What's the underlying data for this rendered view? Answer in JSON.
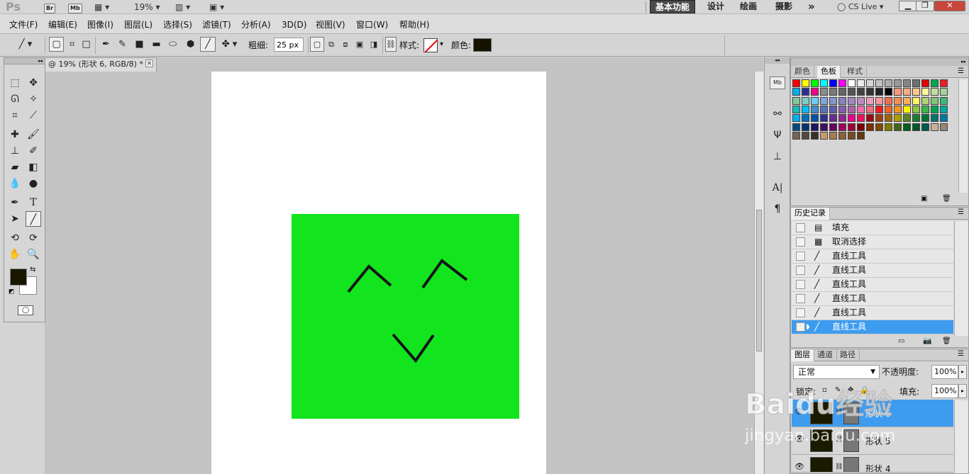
{
  "app_bar": {
    "logo": "Ps",
    "br": "Br",
    "mb": "Mb",
    "zoom": "19%",
    "workspaces": [
      "基本功能",
      "设计",
      "绘画",
      "摄影"
    ],
    "more": "»",
    "cslive": "CS Live"
  },
  "menus": [
    "文件(F)",
    "编辑(E)",
    "图像(I)",
    "图层(L)",
    "选择(S)",
    "滤镜(T)",
    "分析(A)",
    "3D(D)",
    "视图(V)",
    "窗口(W)",
    "帮助(H)"
  ],
  "options": {
    "weight_label": "粗细:",
    "weight_value": "25 px",
    "style_label": "样式:",
    "color_label": "颜色:",
    "color_value": "#151200"
  },
  "document": {
    "tab_title": "@ 19% (形状 6, RGB/8) *",
    "rect_color": "#12e51e",
    "stroke_color": "#151515"
  },
  "toolbox": {
    "fg_color": "#1a1700",
    "bg_color": "#ffffff"
  },
  "swatches_panel": {
    "tabs": [
      "颜色",
      "色板",
      "样式"
    ],
    "active_tab": "色板",
    "swatches": [
      "#ff0000",
      "#ffff00",
      "#00ff00",
      "#00ffff",
      "#0000ff",
      "#ff00ff",
      "#ffffff",
      "#ebebeb",
      "#d6d6d6",
      "#c2c2c2",
      "#adadad",
      "#999999",
      "#858585",
      "#707070",
      "#e00000",
      "#00a651",
      "#ed1c24",
      "#00aeef",
      "#2e3192",
      "#ec008c",
      "#8c8c8c",
      "#7a7a7a",
      "#666666",
      "#555555",
      "#444444",
      "#333333",
      "#222222",
      "#000000",
      "#f7977a",
      "#f9ad81",
      "#fdc68a",
      "#fff79a",
      "#c4df9b",
      "#a3d39c",
      "#82ca9d",
      "#7bcdc8",
      "#6ecff6",
      "#7ea7d8",
      "#8493ca",
      "#8882be",
      "#a187be",
      "#bc8dbf",
      "#f49ac2",
      "#f6989d",
      "#f26c4f",
      "#f68e55",
      "#fbaf5c",
      "#fff467",
      "#acd372",
      "#7cc576",
      "#3bb878",
      "#1abbb4",
      "#00bff3",
      "#438ccb",
      "#5574b9",
      "#605ca8",
      "#8560a8",
      "#a864a8",
      "#f06eaa",
      "#f26d7d",
      "#ed1c24",
      "#f26522",
      "#f7941d",
      "#fff200",
      "#8dc63f",
      "#39b54a",
      "#00a651",
      "#00a99d",
      "#00aeef",
      "#0072bc",
      "#0054a6",
      "#2e3192",
      "#662d91",
      "#92278f",
      "#ec008c",
      "#ed145b",
      "#9e0b0f",
      "#a0410d",
      "#a3620a",
      "#aba000",
      "#598527",
      "#197b30",
      "#007236",
      "#00746b",
      "#0076a3",
      "#004a80",
      "#003471",
      "#1b1464",
      "#440e62",
      "#630460",
      "#9e005d",
      "#9e0039",
      "#790000",
      "#7b2e00",
      "#7d4900",
      "#827b00",
      "#406618",
      "#005e20",
      "#005826",
      "#005952",
      "#c7b299",
      "#998675",
      "#736357",
      "#534741",
      "#37302d",
      "#c69c6d",
      "#a67c52",
      "#8c6239",
      "#754c24",
      "#603913"
    ]
  },
  "history_panel": {
    "title": "历史记录",
    "items": [
      {
        "icon": "fill-icon",
        "label": "填充"
      },
      {
        "icon": "deselect-icon",
        "label": "取消选择"
      },
      {
        "icon": "line-icon",
        "label": "直线工具"
      },
      {
        "icon": "line-icon",
        "label": "直线工具"
      },
      {
        "icon": "line-icon",
        "label": "直线工具"
      },
      {
        "icon": "line-icon",
        "label": "直线工具"
      },
      {
        "icon": "line-icon",
        "label": "直线工具"
      },
      {
        "icon": "line-icon",
        "label": "直线工具"
      }
    ]
  },
  "layers_panel": {
    "tabs": [
      "图层",
      "通道",
      "路径"
    ],
    "blend_mode": "正常",
    "opacity_label": "不透明度:",
    "opacity_value": "100%",
    "lock_label": "锁定:",
    "fill_label": "填充:",
    "fill_value": "100%",
    "layers": [
      {
        "name": "形状 6"
      },
      {
        "name": "形状 5"
      },
      {
        "name": "形状 4"
      }
    ]
  },
  "watermark": {
    "line1": "Baidu经验",
    "line2": "jingyan.baidu.com"
  }
}
